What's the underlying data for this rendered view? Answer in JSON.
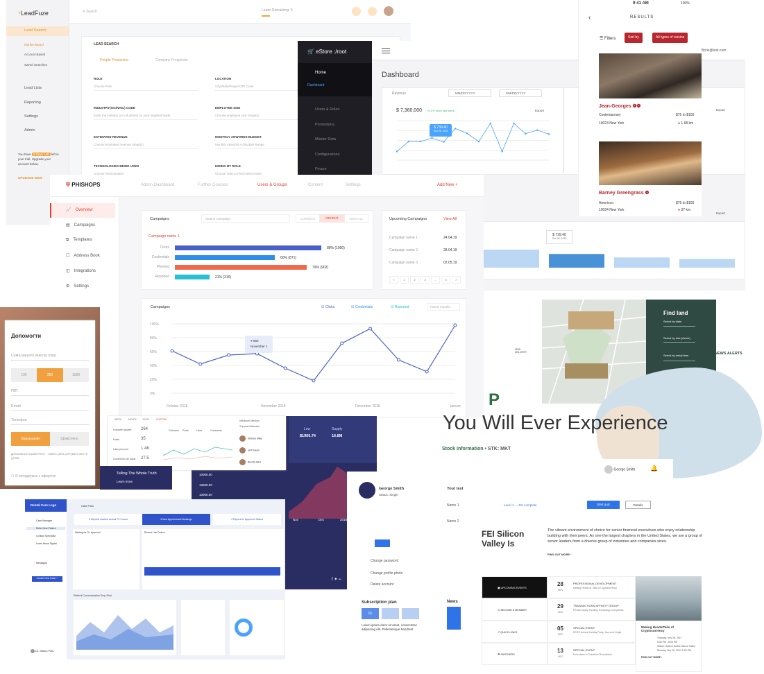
{
  "leadfuze": {
    "logo": "LeadFuze",
    "search_ph": "Search",
    "leads_remaining": "Leads Remaining: 0",
    "nav": {
      "lead_search": "Lead Search",
      "market_based": "Market Based",
      "account_based": "Account Based",
      "saved_searches": "Saved Searches",
      "lead_lists": "Lead Lists",
      "reporting": "Reporting",
      "settings": "Settings",
      "admin": "Admin"
    },
    "trial": {
      "you_have": "You have",
      "badge": "6 Days Left",
      "rest": "left in your trial. Upgrade your account below.",
      "upgrade": "UPGRADE NOW"
    },
    "panel_title": "LEAD SEARCH",
    "tab_people": "People Prospector",
    "tab_company": "Company Prospector",
    "fields": [
      {
        "label": "ROLE",
        "ph": "Choose Role"
      },
      {
        "label": "LOCATION",
        "ph": "City/State/Region/ZIP Code"
      },
      {
        "label": "INDUSTRY(SIC/NAIC) CODE",
        "ph": "Enter the industry (or industries) for your targeted leads"
      },
      {
        "label": "EMPLOYEE SIZE",
        "ph": "Choose employee size range(s)"
      },
      {
        "label": "ESTIMATED REVENUE",
        "ph": "Choose estimated revenue range(s)"
      },
      {
        "label": "MONTHLY ADWORDS BUDGET",
        "ph": "Monthly Adwords Ad Budget Range"
      },
      {
        "label": "TECHNOLOGIES BEING USED",
        "ph": "Choose Technologies"
      },
      {
        "label": "HIRING BY ROLE",
        "ph": "Choose Role to Find Hiring Roles"
      }
    ]
  },
  "mobile": {
    "time": "9:41 AM",
    "battery": "100%",
    "title": "RESULTS",
    "filters": "Filters",
    "sort_by": "Sort by",
    "cuisine": "All types of cuisine",
    "r1": {
      "name": "Jean-Georges",
      "type": "Contemporary",
      "price": "$75 to $150",
      "address": "10023 New York",
      "dist": "1.68 km"
    },
    "r2": {
      "name": "Barney Greengrass",
      "type": "Americon",
      "price": "$75 to $150",
      "address": "10024 New York",
      "dist": "37 km"
    }
  },
  "estore": {
    "brand": "eStore :/root",
    "nav": {
      "home": "Home",
      "dashboard": "Dashboard",
      "users": "Users & Roles",
      "promotions": "Promotions",
      "master": "Master Data",
      "config": "Configurations",
      "finance": "Finace"
    },
    "title": "Dashboard",
    "user_email": "Boris@test.com",
    "revenue": "Revenue",
    "date_ph": "MM/DD/YYYY",
    "total": "$ 7,360,000",
    "growth": "+5,1% since last week",
    "export": "Export",
    "tip_val": "$ 739.40",
    "tip_date": "Sun 06, 2016",
    "tip2_val": "$ 739.40",
    "tip2_date": "Sun 06, 2016",
    "chart_data": {
      "type": "line",
      "values": [
        0.22,
        0.47,
        0.47,
        0.56,
        0.46,
        0.8,
        0.68,
        0.47,
        0.93,
        0.22,
        0.93,
        0.67,
        0.76,
        0.66
      ],
      "ylim": [
        0,
        1
      ]
    },
    "bar_chart": {
      "type": "bar",
      "values": [
        0.62,
        0.47,
        0.35,
        0.3,
        0.22
      ],
      "ylim": [
        0,
        1
      ]
    }
  },
  "phishops": {
    "brand": "PHISHOPS",
    "tabs": [
      "Admin Dashboard",
      "Further Courses",
      "Users & Groups",
      "Content",
      "Settings"
    ],
    "add_new": "Add New +",
    "side": [
      "Overview",
      "Campaigns",
      "Templates",
      "Address Book",
      "Integrations",
      "Settings"
    ],
    "campaigns": "Campaigns",
    "search_ph": "Search Campaign",
    "seg": [
      "CURRENT",
      "RECENT",
      "VIEW ALL"
    ],
    "camp_name": "Campaign name 1",
    "bars": [
      {
        "label": "Clicks",
        "text": "88% (1000)",
        "value": 0.88
      },
      {
        "label": "Credentials",
        "text": "60% (871)",
        "value": 0.6
      },
      {
        "label": "Phished",
        "text": "79% (902)",
        "value": 0.79
      },
      {
        "label": "Reported",
        "text": "21% (316)",
        "value": 0.21
      }
    ],
    "upcoming": "Upcoming Campaigns",
    "view_all": "View All",
    "up_rows": [
      {
        "name": "Campaign name 1",
        "date": "24.04.19"
      },
      {
        "name": "Campaign name 2",
        "date": "28.04.19"
      },
      {
        "name": "Campaign name 3",
        "date": "02.05.19"
      }
    ],
    "pager": [
      "<",
      "1",
      "2",
      "3",
      "...",
      "5",
      ">"
    ],
    "chart2_title": "Campaigns",
    "legend": [
      "Clicks",
      "Credentials",
      "Reported"
    ],
    "past_label": "Past 6 months",
    "tip_val": "860",
    "tip_date": "November 1",
    "chart_data": {
      "type": "line",
      "x": [
        "October 2018",
        "November 2018",
        "December 2018",
        "January 2019"
      ],
      "values": [
        61,
        42,
        55,
        57,
        36,
        18,
        72,
        93,
        48,
        31,
        98
      ],
      "ylim": [
        0,
        100
      ],
      "ticks": [
        "100%",
        "80%",
        "60%",
        "40%",
        "20%",
        "0%"
      ]
    }
  },
  "donate": {
    "title": "Допомогти",
    "amount_ph": "Сума вашого внеску (грн)",
    "amounts": [
      "100",
      "250",
      "1000"
    ],
    "name_ph": "ПІП",
    "email_ph": "Email",
    "phone_ph": "Телефон",
    "once": "Одноразово",
    "monthly": "Щомісячно",
    "note": "Допомагати щомісячно – навіть день рятувати життя дітям",
    "agree": "Я погоджуюсь з офертою"
  },
  "analytics": {
    "tabs": [
      "WEEK",
      "MONTH",
      "YEAR",
      "CUSTOM"
    ],
    "rows": [
      {
        "label": "Followers growth",
        "value": "264"
      },
      {
        "label": "Posts",
        "value": "35"
      },
      {
        "label": "Likes per post",
        "value": "1.4K"
      },
      {
        "label": "Comments per posts",
        "value": "27.5"
      }
    ],
    "legend": [
      "Followers",
      "Posts",
      "Likes",
      "Comments"
    ],
    "list": [
      "Michele Miller",
      "Jeff Ockerr",
      "Brenda Blue"
    ],
    "tab_list": [
      "Influencer Medium",
      "Top post influencer"
    ]
  },
  "dark": {
    "low_label": "Low",
    "low_val": "$1900.74",
    "supply_label": "Supply",
    "supply_val": "16.8M",
    "y": [
      "10000.00",
      "12500.00",
      "10000.00"
    ],
    "x": [
      "Nov",
      "Dec",
      "2018"
    ],
    "story": "Telling The Whole Truth",
    "learn": "Learn more"
  },
  "dental": {
    "logo": "Dental Care Logo",
    "nav": [
      "Case Manager",
      "Refer New Patient",
      "Contact Specialist",
      "Learn About Digital",
      "Messages"
    ],
    "new_case": "Create New Case +",
    "doctor": "Dr. Marco Polo",
    "files": "CAD Files",
    "tabs": [
      "6 Reports marked annual 73+ hours",
      "4 New Appointment Bookings",
      "4 Reports In Approved Status"
    ],
    "waiting": "Waiting for Dr. Approval",
    "recent": "Recent Lab Orders",
    "chart_title": "Referral Communication Drop-Shot"
  },
  "profile": {
    "name": "George Smith",
    "status": "Status: Single",
    "change_pw": "Change password",
    "change_photo": "Change profile photo",
    "delete": "Delete account",
    "sub": "Subscription plan",
    "lorem": "Lorem ipsum dolor sit amet, consectetur adipiscing elit. Pellentesque hendrerit",
    "sub_btns": [
      "01",
      "02",
      "03"
    ]
  },
  "test": {
    "user": "George Smith",
    "your_test": "Your test",
    "rows": [
      {
        "name": "Name 1",
        "level": "Level 1 — 5% complete",
        "btn": "Start quiz",
        "details": "Details"
      },
      {
        "name": "Name 2",
        "level": "Level 3 — 100% complete",
        "btn": "Unlock Level 4",
        "details": "Details"
      }
    ]
  },
  "land": {
    "title": "Find land",
    "state": "Select by state",
    "size": "Select by size (Acres)",
    "rental": "Select by rental time",
    "greenhouses": "Industrial greenhouses",
    "service": "Service included",
    "map_mark": "NEW DELIVERY",
    "news": "NEWS ALERTS"
  },
  "hero": {
    "p": "P",
    "title": "You Will Ever Experience",
    "stock": "Stock Information",
    "stk": "• STK: MKT"
  },
  "fei": {
    "title": "FEI Silicon Valley Is",
    "text": "The vibrant environment of choice for senior financial executives who enjoy relationship building with their peers. As one the largest chapters in the United States, we are a group of senior leaders from a diverse group of industries and companies sizes.",
    "more": "FIND OUT MORE",
    "menu": [
      "UPCOMING EVENTS",
      "BECOME A MEMBER",
      "QUICK LINKS",
      "PARTNERS"
    ],
    "events": [
      {
        "day": "28",
        "mon": "NOV",
        "type": "PROFESSIONAL DEVELOPMENT",
        "title": "Making Heads or Tails of Cryptocurrency"
      },
      {
        "day": "29",
        "mon": "NOV",
        "type": "TRANSACTIONS AFFINITY GROUP",
        "title": "Private Equity Funding Technology Companies"
      },
      {
        "day": "05",
        "mon": "DEC",
        "type": "SPECIAL EVENT",
        "title": "FEISV Annual Holiday Party, Jazz and Jingle"
      },
      {
        "day": "13",
        "mon": "DEC",
        "type": "SPECIAL EVENT",
        "title": "Executives in Transition Roundtable"
      }
    ],
    "card": {
      "title": "Making Heads/Tails of Cryptocurrency",
      "date": "Tuesday, Nov 28, 2017",
      "time": "5:30 PM - 8:00 PM",
      "where": "Silicon Hotel & Suites Silicon Valley",
      "price": "Monday, Nov 20, 2017 5:00 PM",
      "more": "FIND OUT MORE"
    },
    "news": "News"
  },
  "colors": {
    "leadfuze_accent": "#f0a43a",
    "estore_dark": "#1e1e24",
    "phish_red": "#e0412f",
    "blue": "#4a76d1",
    "land_green": "#2f4a42",
    "dental_blue": "#2f54c9",
    "night": "#2a2d62"
  }
}
